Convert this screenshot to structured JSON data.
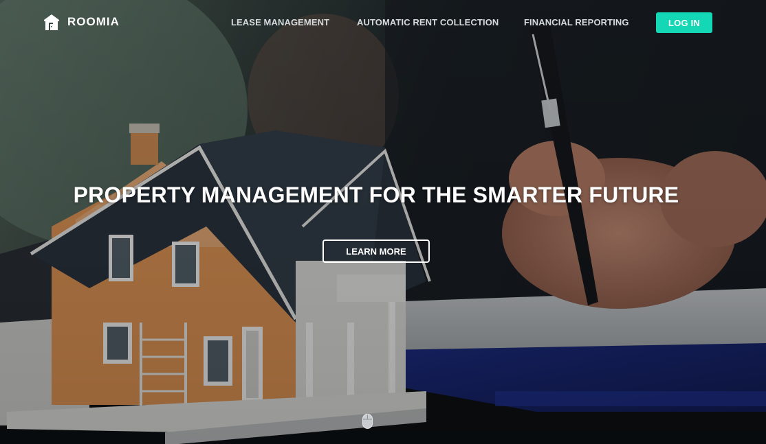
{
  "brand": {
    "name": "ROOMIA",
    "logo_icon": "building-logo-icon"
  },
  "nav": {
    "links": [
      {
        "label": "LEASE MANAGEMENT"
      },
      {
        "label": "AUTOMATIC RENT COLLECTION"
      },
      {
        "label": "FINANCIAL REPORTING"
      }
    ],
    "login_label": "LOG IN"
  },
  "hero": {
    "headline": "PROPERTY MANAGEMENT FOR THE SMARTER FUTURE",
    "cta_label": "LEARN MORE",
    "scroll_icon": "mouse-scroll-icon"
  },
  "colors": {
    "accent": "#13d7b5",
    "text": "#ffffff",
    "nav_text": "#d7dadd"
  }
}
